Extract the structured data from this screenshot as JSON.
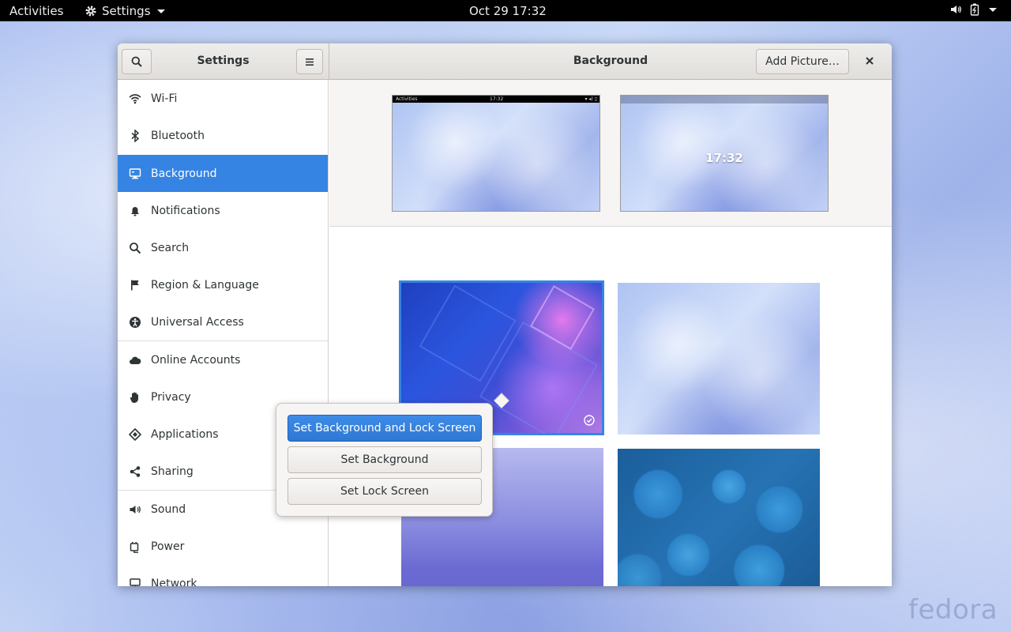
{
  "topbar": {
    "activities": "Activities",
    "app_menu": "Settings",
    "clock": "Oct 29  17:32"
  },
  "watermark": "fedora",
  "window": {
    "sidebar_title": "Settings",
    "panel_title": "Background",
    "add_picture": "Add Picture…"
  },
  "sidebar": {
    "items": [
      {
        "label": "Wi-Fi",
        "icon": "wifi-icon"
      },
      {
        "label": "Bluetooth",
        "icon": "bluetooth-icon"
      },
      {
        "label": "Background",
        "icon": "background-icon",
        "active": true
      },
      {
        "label": "Notifications",
        "icon": "bell-icon"
      },
      {
        "label": "Search",
        "icon": "search-icon"
      },
      {
        "label": "Region & Language",
        "icon": "flag-icon"
      },
      {
        "label": "Universal Access",
        "icon": "accessibility-icon"
      },
      {
        "label": "Online Accounts",
        "icon": "cloud-icon"
      },
      {
        "label": "Privacy",
        "icon": "hand-icon"
      },
      {
        "label": "Applications",
        "icon": "applications-icon"
      },
      {
        "label": "Sharing",
        "icon": "share-icon"
      },
      {
        "label": "Sound",
        "icon": "speaker-icon"
      },
      {
        "label": "Power",
        "icon": "power-icon"
      },
      {
        "label": "Network",
        "icon": "network-icon"
      }
    ]
  },
  "preview": {
    "mini_activities": "Activities",
    "mini_clock": "17:32",
    "lock_time": "17:32"
  },
  "popover": {
    "set_both": "Set Background and Lock Screen",
    "set_background": "Set Background",
    "set_lock": "Set Lock Screen"
  },
  "colors": {
    "accent": "#3584e4",
    "topbar": "#000000"
  }
}
